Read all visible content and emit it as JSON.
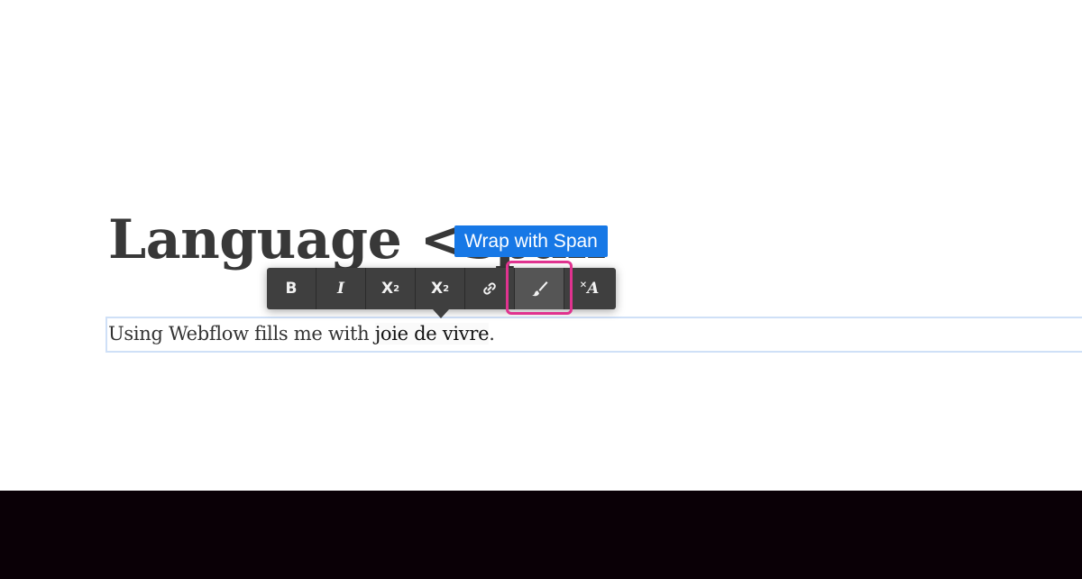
{
  "heading": {
    "text": "Language <span"
  },
  "paragraph": {
    "before": "Using Webflow fills me with ",
    "selected": "joie de vivre",
    "after": "."
  },
  "toolbar": {
    "bold_label": "B",
    "italic_label": "I",
    "superscript_base": "X",
    "superscript_mark": "2",
    "subscript_base": "X",
    "subscript_mark": "2",
    "link_icon": "link-icon",
    "span_icon": "brush-icon",
    "clear_label": "A",
    "clear_mark": "×"
  },
  "tooltip": {
    "text": "Wrap with Span"
  },
  "colors": {
    "toolbar_bg": "#3f3f3f",
    "tooltip_bg": "#1778e6",
    "highlight": "#e0338f",
    "footer_bg": "#0a0006",
    "footer_text": "#e8328d"
  }
}
